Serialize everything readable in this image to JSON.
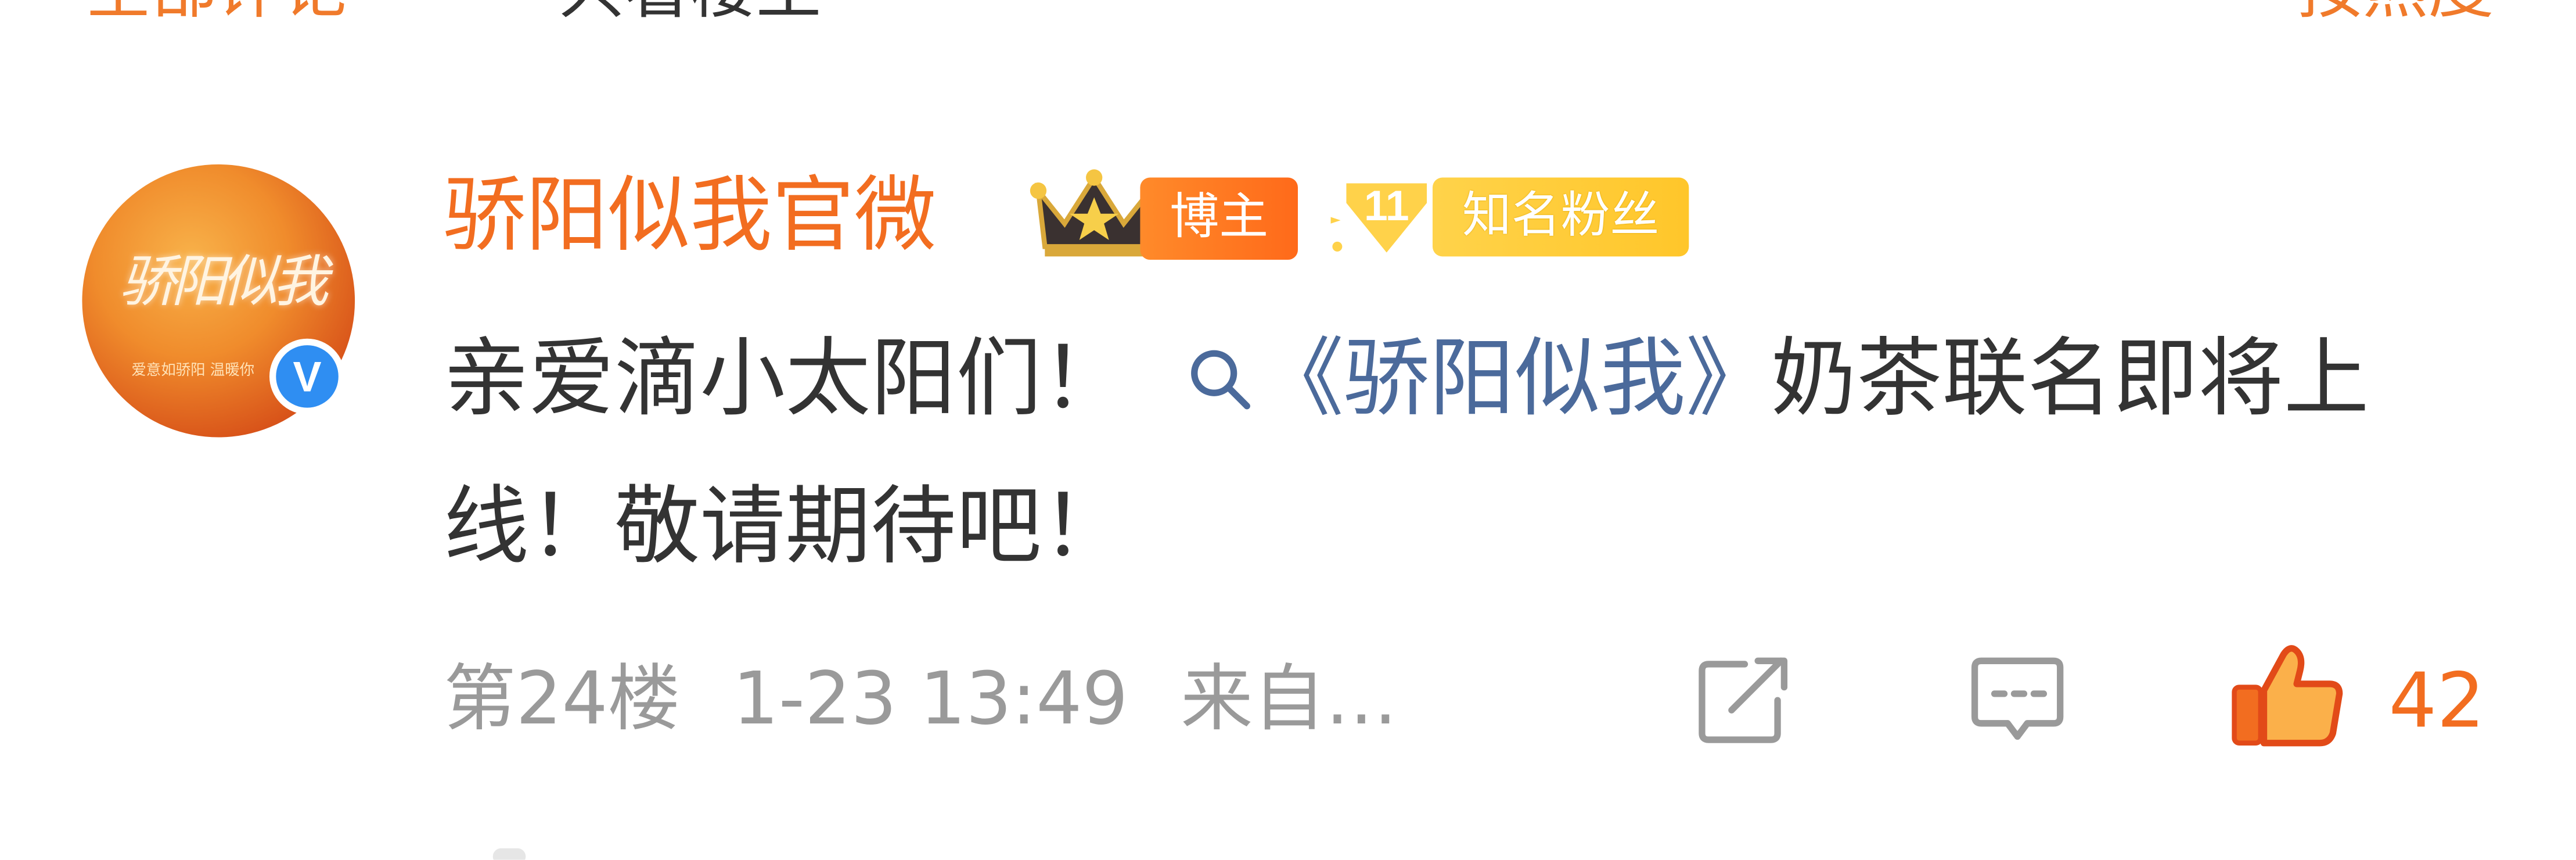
{
  "top_row": {
    "left_a": "全部评论",
    "left_b": "只看楼主",
    "right": "按热度"
  },
  "comment": {
    "avatar": {
      "title_text": "骄阳似我",
      "subtitle_text": "爱意如骄阳 温暖你"
    },
    "verified_glyph": "V",
    "username": "骄阳似我官微",
    "badges": {
      "bozhu": "博主",
      "fan_level": "11",
      "fan_label": "知名粉丝"
    },
    "content": {
      "part1": "亲爱滴小太阳们！",
      "topic": "《骄阳似我》",
      "part2": "奶茶联名即将上线！敬请期待吧！"
    },
    "meta": {
      "floor": "第24楼",
      "datetime": "1-23 13:49",
      "source": "来自…"
    },
    "likes": "42"
  },
  "colors": {
    "username": "#f26d20",
    "topic": "#4b6a9b",
    "meta": "#9a9a9a",
    "like": "#f26d20",
    "verified": "#2f8ef2",
    "fan_badge": "#ffc62a",
    "bozhu_badge": "#ff7a22"
  },
  "icons": {
    "crown": "crown-icon",
    "verified": "verified-icon",
    "fan_shield": "fan-shield-icon",
    "search": "search-icon",
    "share": "share-icon",
    "comment": "comment-icon",
    "like": "thumbs-up-icon"
  }
}
